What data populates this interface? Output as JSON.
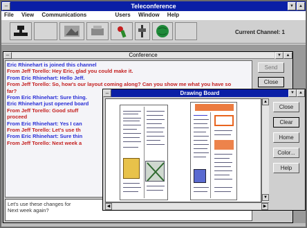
{
  "app": {
    "title": "Teleconference",
    "menu": [
      "File",
      "View",
      "Communications",
      "Users",
      "Window",
      "Help"
    ],
    "current_channel_label": "Current Channel: 1"
  },
  "conference": {
    "title": "Conference",
    "send_label": "Send",
    "close_label": "Close",
    "messages": [
      {
        "text": "Eric Rhinehart is joined this channel",
        "color": "blue"
      },
      {
        "text": "From Jeff Torello: Hey Eric, glad you could make it.",
        "color": "red"
      },
      {
        "text": "From Eric Rhinehart: Hello Jeff.",
        "color": "blue"
      },
      {
        "text": "From Jeff Torello: So, how's our layout coming along? Can you show me what you have so",
        "color": "red"
      },
      {
        "text": "  far?",
        "color": "red"
      },
      {
        "text": "From Eric Rhinehart: Sure thing.",
        "color": "blue"
      },
      {
        "text": "Eric Rhinehart just opened board",
        "color": "blue"
      },
      {
        "text": "From Jeff Torello: Good stuff",
        "color": "red"
      },
      {
        "text": "  proceed",
        "color": "red"
      },
      {
        "text": "From Eric Rhinehart: Yes I can",
        "color": "blue"
      },
      {
        "text": "From Jeff Torello: Let's use th",
        "color": "red"
      },
      {
        "text": "From Eric Rhinehart: Sure thin",
        "color": "blue"
      },
      {
        "text": "From Jeff Torello: Next week a",
        "color": "red"
      }
    ],
    "input_lines": [
      "Let's use these changes for",
      "Next week again?"
    ]
  },
  "drawing_board": {
    "title": "Drawing Board",
    "buttons": [
      "Close",
      "Clear",
      "Home",
      "Color...",
      "Help"
    ]
  },
  "colors": {
    "titlebar": "#0a1fa6",
    "sender_blue": "#2a2fd6",
    "sender_red": "#c41f1f",
    "window_face": "#c9c9c9",
    "drawing_orange": "#e8641e"
  },
  "toolbar_icons": [
    "stamp-icon",
    "blank-tool-icon",
    "image-tool-icon",
    "machine-icon",
    "pen-icon",
    "slider-icon",
    "globe-icon",
    "blank-tool-icon"
  ]
}
